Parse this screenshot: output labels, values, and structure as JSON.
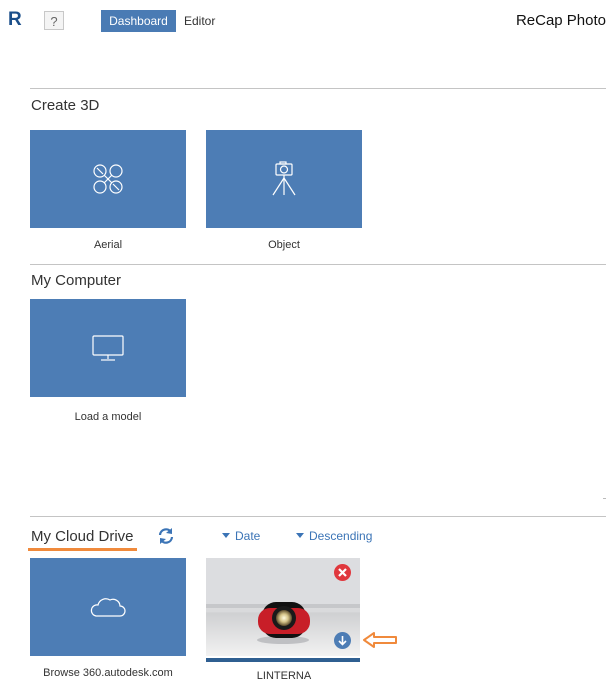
{
  "header": {
    "logo": "R",
    "help_label": "?",
    "tabs": [
      {
        "label": "Dashboard",
        "active": true
      },
      {
        "label": "Editor",
        "active": false
      }
    ],
    "app_title": "ReCap Photo"
  },
  "sections": {
    "create_3d": {
      "title": "Create 3D",
      "tiles": [
        {
          "label": "Aerial",
          "icon": "drone-icon"
        },
        {
          "label": "Object",
          "icon": "camera-tripod-icon"
        }
      ]
    },
    "my_computer": {
      "title": "My Computer",
      "tiles": [
        {
          "label": "Load a model",
          "icon": "monitor-icon"
        }
      ]
    },
    "cloud_drive": {
      "title": "My Cloud Drive",
      "sort_field": "Date",
      "sort_order": "Descending",
      "tiles": [
        {
          "label": "Browse 360.autodesk.com",
          "icon": "cloud-icon"
        },
        {
          "label": "LINTERNA",
          "icon": "photo-thumbnail"
        }
      ]
    }
  },
  "colors": {
    "tile_blue": "#4d7db5",
    "accent_blue": "#3b74b6",
    "highlight_orange": "#f08a3c",
    "delete_red": "#e0383e"
  }
}
